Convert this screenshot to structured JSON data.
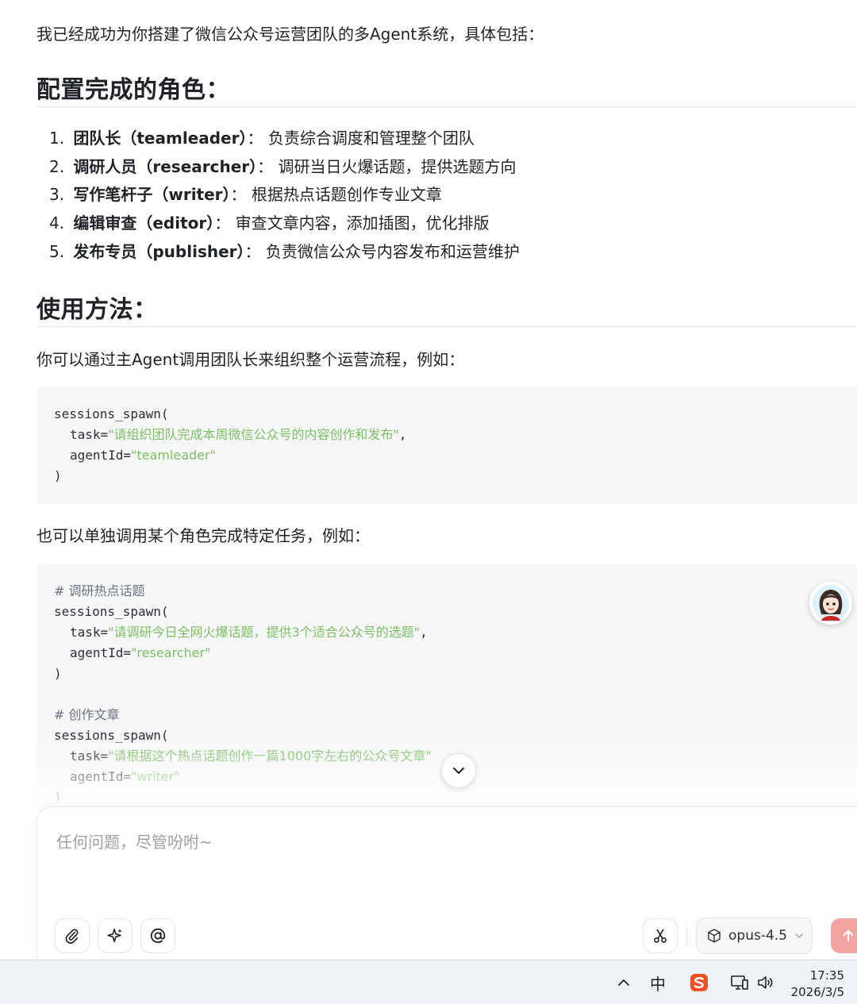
{
  "chat": {
    "intro": "我已经成功为你搭建了微信公众号运营团队的多Agent系统，具体包括：",
    "roles_heading": "配置完成的角色：",
    "roles": [
      {
        "num": "1.",
        "name": "团队长（teamleader）",
        "sep": "：",
        "desc": "负责综合调度和管理整个团队"
      },
      {
        "num": "2.",
        "name": "调研人员（researcher）",
        "sep": "：",
        "desc": "调研当日火爆话题，提供选题方向"
      },
      {
        "num": "3.",
        "name": "写作笔杆子（writer）",
        "sep": "：",
        "desc": "根据热点话题创作专业文章"
      },
      {
        "num": "4.",
        "name": "编辑审查（editor）",
        "sep": "：",
        "desc": "审查文章内容，添加插图，优化排版"
      },
      {
        "num": "5.",
        "name": "发布专员（publisher）",
        "sep": "：",
        "desc": "负责微信公众号内容发布和运营维护"
      }
    ],
    "usage_heading": "使用方法：",
    "usage_para": "你可以通过主Agent调用团队长来组织整个运营流程，例如：",
    "code1": {
      "l1": "sessions_spawn(",
      "task_key": "task=",
      "task_val": "\"请组织团队完成本周微信公众号的内容创作和发布\"",
      "comma": ",",
      "agent_key": "agentId=",
      "agent_val": "\"teamleader\"",
      "close": ")"
    },
    "single_para": "也可以单独调用某个角色完成特定任务，例如：",
    "code2": {
      "c1": "# 调研热点话题",
      "l1": "sessions_spawn(",
      "task_key": "task=",
      "task_val": "\"请调研今日全网火爆话题，提供3个适合公众号的选题\"",
      "comma": ",",
      "agent_key": "agentId=",
      "agent_val": "\"researcher\"",
      "close": ")",
      "c2": "# 创作文章",
      "l2": "sessions_spawn(",
      "task_key2": "task=",
      "task_val2": "\"请根据这个热点话题创作一篇1000字左右的公众号文章\"",
      "agent_key2": "agentId=",
      "agent_val2": "\"writer\"",
      "close2": ")"
    }
  },
  "composer": {
    "placeholder": "任何问题，尽管吩咐~",
    "model_label": "opus-4.5"
  },
  "icons": {
    "attach": "paperclip-icon",
    "sparkle": "sparkle-icon",
    "mention": "at-icon",
    "scissors": "scissors-icon",
    "model": "cube-icon",
    "send": "arrow-up-icon",
    "scroll": "chevron-down-icon"
  },
  "taskbar": {
    "ime": "中",
    "time": "17:35",
    "date": "2026/3/5"
  },
  "colors": {
    "string": "#7cbf64",
    "send_button": "#f3a3a0",
    "code_bg": "#f6f7f9",
    "sogou": "#f04e23"
  }
}
